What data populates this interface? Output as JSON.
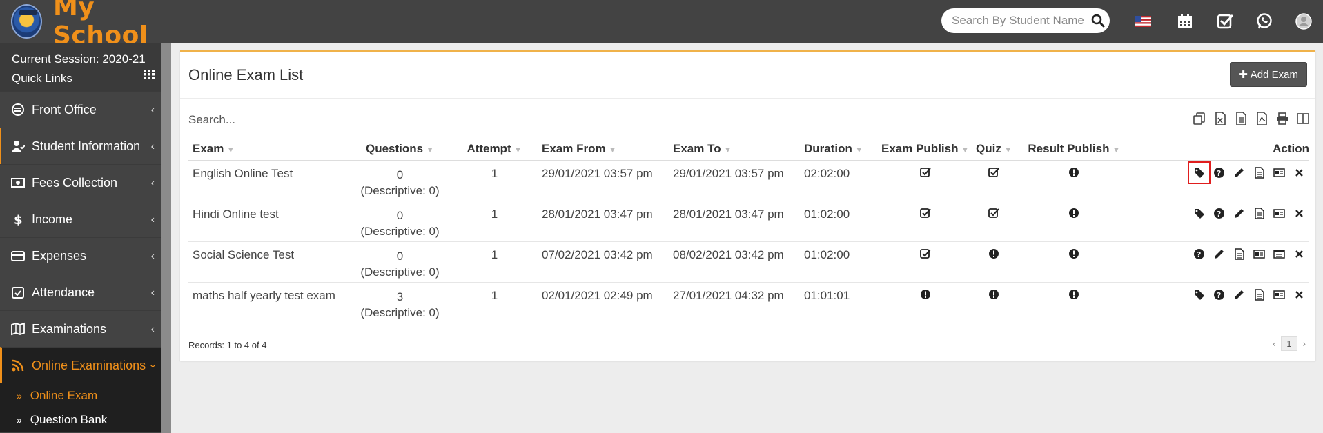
{
  "header": {
    "app_name": "My School",
    "search_placeholder": "Search By Student Name"
  },
  "sidebar": {
    "session": "Current Session: 2020-21",
    "quick_links": "Quick Links",
    "items": [
      {
        "label": "Front Office"
      },
      {
        "label": "Student Information"
      },
      {
        "label": "Fees Collection"
      },
      {
        "label": "Income"
      },
      {
        "label": "Expenses"
      },
      {
        "label": "Attendance"
      },
      {
        "label": "Examinations"
      },
      {
        "label": "Online Examinations"
      }
    ],
    "sub_items": [
      {
        "label": "Online Exam"
      },
      {
        "label": "Question Bank"
      }
    ]
  },
  "panel": {
    "title": "Online Exam List",
    "add_button": "Add Exam",
    "search_placeholder": "Search..."
  },
  "table": {
    "columns": [
      "Exam",
      "Questions",
      "Attempt",
      "Exam From",
      "Exam To",
      "Duration",
      "Exam Publish",
      "Quiz",
      "Result Publish",
      "Action"
    ],
    "rows": [
      {
        "exam": "English Online Test",
        "questions": "0",
        "descriptive": "(Descriptive: 0)",
        "attempt": "1",
        "from": "29/01/2021 03:57 pm",
        "to": "29/01/2021 03:57 pm",
        "duration": "02:02:00",
        "exam_publish": "checked",
        "quiz": "checked",
        "result_publish": "alert"
      },
      {
        "exam": "Hindi Online test",
        "questions": "0",
        "descriptive": "(Descriptive: 0)",
        "attempt": "1",
        "from": "28/01/2021 03:47 pm",
        "to": "28/01/2021 03:47 pm",
        "duration": "01:02:00",
        "exam_publish": "checked",
        "quiz": "checked",
        "result_publish": "alert"
      },
      {
        "exam": "Social Science Test",
        "questions": "0",
        "descriptive": "(Descriptive: 0)",
        "attempt": "1",
        "from": "07/02/2021 03:42 pm",
        "to": "08/02/2021 03:42 pm",
        "duration": "01:02:00",
        "exam_publish": "checked",
        "quiz": "alert",
        "result_publish": "alert"
      },
      {
        "exam": "maths half yearly test exam",
        "questions": "3",
        "descriptive": "(Descriptive: 0)",
        "attempt": "1",
        "from": "02/01/2021 02:49 pm",
        "to": "27/01/2021 04:32 pm",
        "duration": "01:01:01",
        "exam_publish": "alert",
        "quiz": "alert",
        "result_publish": "alert"
      }
    ]
  },
  "footer": {
    "records": "Records: 1 to 4 of 4",
    "page": "1"
  },
  "colors": {
    "accent": "#f0901a",
    "header_bg": "#434343",
    "highlight_box": "#e01e1e"
  }
}
